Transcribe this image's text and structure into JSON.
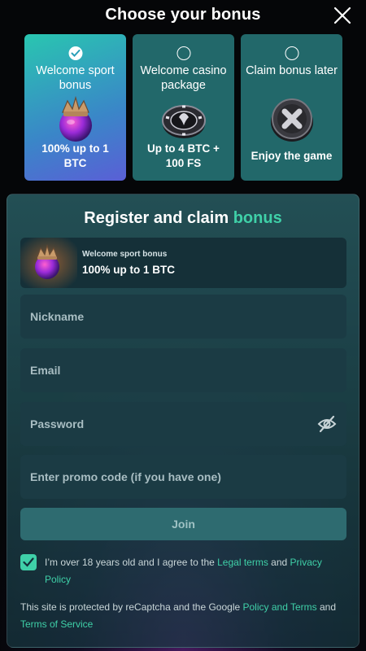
{
  "header": {
    "title": "Choose your bonus",
    "close_icon": "close-icon"
  },
  "bonus_cards": [
    {
      "title": "Welcome sport bonus",
      "subtitle": "100% up to 1 BTC",
      "selected": true,
      "icon": "trophy-ball-icon"
    },
    {
      "title": "Welcome casino package",
      "subtitle": "Up to 4 BTC + 100 FS",
      "selected": false,
      "icon": "casino-chip-icon"
    },
    {
      "title": "Claim bonus later",
      "subtitle": "Enjoy the game",
      "selected": false,
      "icon": "x-coin-icon"
    }
  ],
  "form": {
    "title_prefix": "Register and claim",
    "title_accent": "bonus",
    "selected_bonus": {
      "label": "Welcome sport bonus",
      "value": "100% up to 1 BTC"
    },
    "nickname_placeholder": "Nickname",
    "email_placeholder": "Email",
    "password_placeholder": "Password",
    "promo_placeholder": "Enter promo code (if you have one)",
    "join_label": "Join",
    "age_checkbox_checked": true,
    "terms_text_1": "I’m over 18 years old and I agree to the ",
    "terms_link_legal": "Legal terms",
    "terms_text_2": " and ",
    "terms_link_privacy": "Privacy Policy",
    "recaptcha_text_1": "This site is protected by reCaptcha and the Google ",
    "recaptcha_link_policy": "Policy and Terms",
    "recaptcha_text_2": " and ",
    "recaptcha_link_tos": "Terms of Service"
  },
  "colors": {
    "accent": "#3fd0a8",
    "card_bg": "#22686a",
    "panel_bg": "#26565c",
    "field_bg": "#1b3b44"
  }
}
